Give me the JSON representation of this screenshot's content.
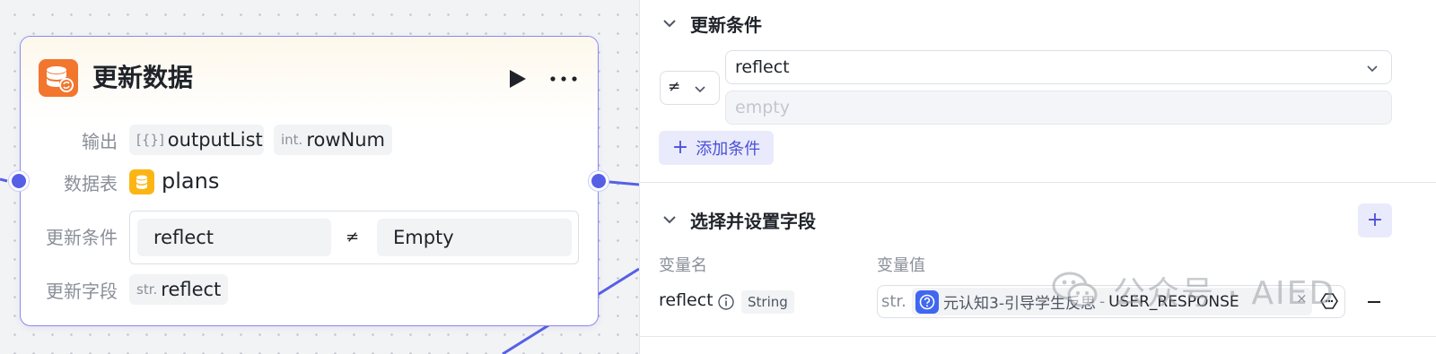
{
  "node": {
    "title": "更新数据",
    "output_label": "输出",
    "outputs": [
      {
        "type": "[{}]",
        "name": "outputList"
      },
      {
        "type": "int.",
        "name": "rowNum"
      }
    ],
    "table_label": "数据表",
    "table_name": "plans",
    "condition_label": "更新条件",
    "condition": {
      "field": "reflect",
      "operator": "≠",
      "value": "Empty"
    },
    "field_label": "更新字段",
    "field": {
      "type": "str.",
      "name": "reflect"
    },
    "icons": {
      "header": "database-sync-icon",
      "table": "database-icon",
      "run": "play-icon",
      "more": "more-icon"
    },
    "colors": {
      "accent": "#5660e6",
      "header_icon": "#f2762e",
      "table_icon": "#fbb615"
    }
  },
  "panel": {
    "conditions_section": {
      "title": "更新条件",
      "operator_symbol": "≠",
      "field_value": "reflect",
      "value_placeholder": "empty",
      "add_button": "添加条件"
    },
    "fields_section": {
      "title": "选择并设置字段",
      "col_name": "变量名",
      "col_value": "变量值",
      "row": {
        "name": "reflect",
        "type_badge": "String",
        "value_type": "str.",
        "ref_node": "元认知3-引导学生反思",
        "ref_sep": "-",
        "ref_var": "USER_RESPONSE"
      }
    },
    "colors": {
      "accent": "#4a4fd6",
      "accent_bg": "#e9ebfc",
      "ref_icon": "#4067f0"
    }
  },
  "watermark": {
    "text": "公众号 · AIED"
  }
}
